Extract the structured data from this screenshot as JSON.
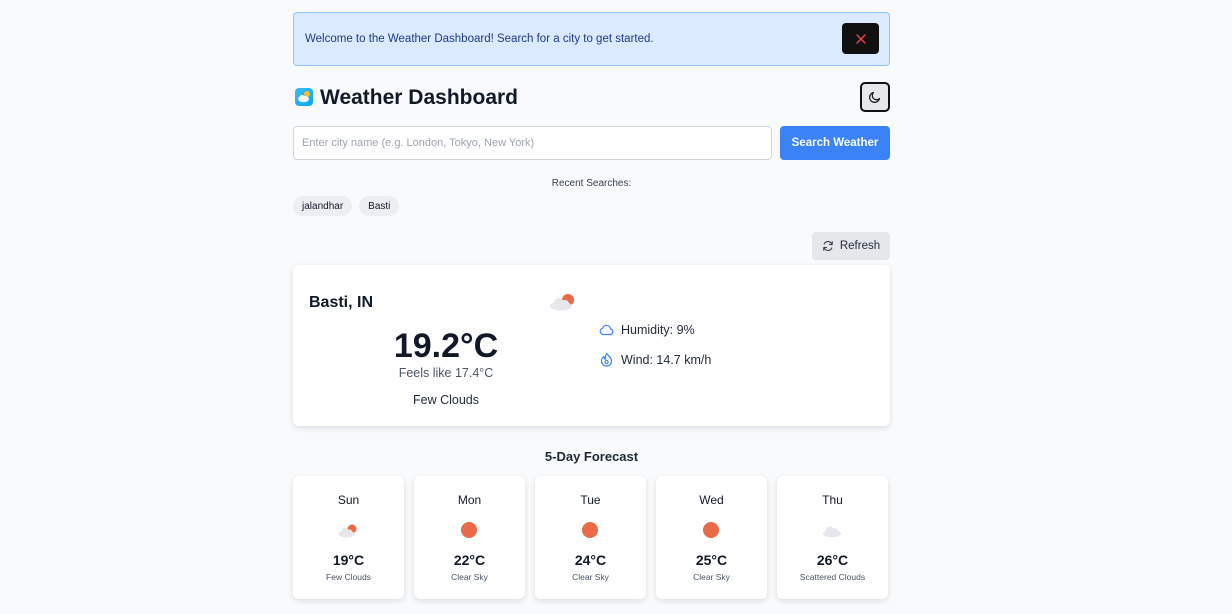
{
  "banner": {
    "message": "Welcome to the Weather Dashboard! Search for a city to get started.",
    "close_icon": "close-icon"
  },
  "header": {
    "title": "Weather Dashboard",
    "logo_icon": "cloud-sun-logo-icon",
    "theme_toggle_icon": "moon-icon"
  },
  "search": {
    "placeholder": "Enter city name (e.g. London, Tokyo, New York)",
    "value": "",
    "button_label": "Search Weather"
  },
  "recent": {
    "label": "Recent Searches:",
    "items": [
      "jalandhar",
      "Basti"
    ]
  },
  "refresh": {
    "label": "Refresh",
    "icon": "refresh-icon"
  },
  "current": {
    "city": "Basti, IN",
    "temperature": "19.2°C",
    "feels_like": "Feels like 17.4°C",
    "description": "Few Clouds",
    "icon": "few-clouds-icon",
    "humidity": "Humidity: 9%",
    "wind": "Wind: 14.7 km/h"
  },
  "forecast": {
    "title": "5-Day Forecast",
    "days": [
      {
        "day": "Sun",
        "temp": "19°C",
        "desc": "Few Clouds",
        "icon": "few-clouds-icon"
      },
      {
        "day": "Mon",
        "temp": "22°C",
        "desc": "Clear Sky",
        "icon": "sun-icon"
      },
      {
        "day": "Tue",
        "temp": "24°C",
        "desc": "Clear Sky",
        "icon": "sun-icon"
      },
      {
        "day": "Wed",
        "temp": "25°C",
        "desc": "Clear Sky",
        "icon": "sun-icon"
      },
      {
        "day": "Thu",
        "temp": "26°C",
        "desc": "Scattered Clouds",
        "icon": "cloud-icon"
      }
    ]
  },
  "colors": {
    "accent": "#3b82f6",
    "banner_bg": "#dbeafe",
    "sun": "#ea6a47",
    "cloud": "#e5e7eb"
  }
}
